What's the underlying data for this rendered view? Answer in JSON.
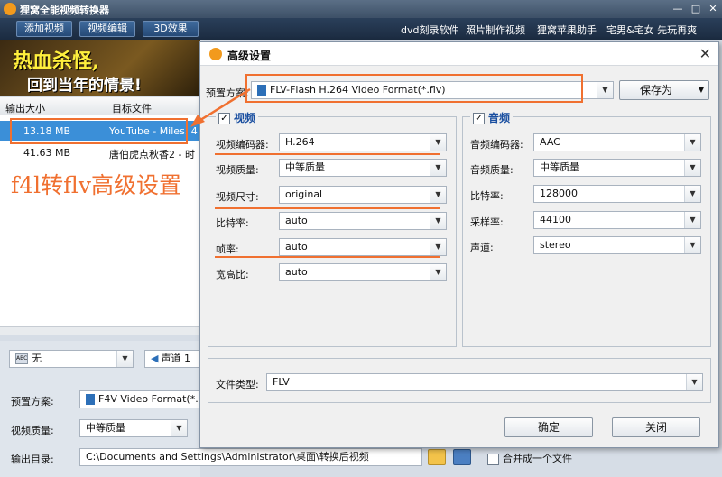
{
  "app": {
    "title": "狸窝全能视频转换器"
  },
  "toolbar": {
    "buttons": [
      "添加视频",
      "视频编辑",
      "3D效果"
    ],
    "links": [
      "dvd刻录软件",
      "照片制作视频",
      "狸窝苹果助手",
      "宅男&宅女 先玩再爽"
    ]
  },
  "banner": {
    "line1": "热血杀怪,",
    "line2": "回到当年的情景!"
  },
  "file_table": {
    "headers": [
      "输出大小",
      "目标文件"
    ],
    "rows": [
      {
        "size": "13.18 MB",
        "target": "YouTube - Miles. 4"
      },
      {
        "size": "41.63 MB",
        "target": "唐伯虎点秋香2 - 时"
      }
    ]
  },
  "subtitle_select": {
    "value": "无",
    "icon": "subtitle-icon"
  },
  "audio_track_select": {
    "value": "声道 1"
  },
  "bottom": {
    "preset_label": "预置方案:",
    "preset_value": "F4V Video Format(*.f4",
    "quality_label": "视频质量:",
    "quality_value": "中等质量",
    "output_label": "输出目录:",
    "output_value": "C:\\Documents and Settings\\Administrator\\桌面\\转换后视频",
    "merge_label": "合并成一个文件"
  },
  "dialog": {
    "title": "高级设置",
    "preset_label": "预置方案:",
    "preset_value": "FLV-Flash H.264 Video Format(*.flv)",
    "save_as": "保存为",
    "video": {
      "title": "视频",
      "fields": [
        {
          "label": "视频编码器:",
          "value": "H.264"
        },
        {
          "label": "视频质量:",
          "value": "中等质量"
        },
        {
          "label": "视频尺寸:",
          "value": "original"
        },
        {
          "label": "比特率:",
          "value": "auto"
        },
        {
          "label": "帧率:",
          "value": "auto"
        },
        {
          "label": "宽高比:",
          "value": "auto"
        }
      ]
    },
    "audio": {
      "title": "音频",
      "fields": [
        {
          "label": "音频编码器:",
          "value": "AAC"
        },
        {
          "label": "音频质量:",
          "value": "中等质量"
        },
        {
          "label": "比特率:",
          "value": "128000"
        },
        {
          "label": "采样率:",
          "value": "44100"
        },
        {
          "label": "声道:",
          "value": "stereo"
        }
      ]
    },
    "file_type_label": "文件类型:",
    "file_type_value": "FLV",
    "ok": "确定",
    "close": "关闭"
  },
  "annotation": {
    "text": "f4l转flv高级设置"
  },
  "colors": {
    "annotation": "#f07030",
    "selected_row": "#3b8fd8",
    "group_title": "#1a4fa0"
  }
}
